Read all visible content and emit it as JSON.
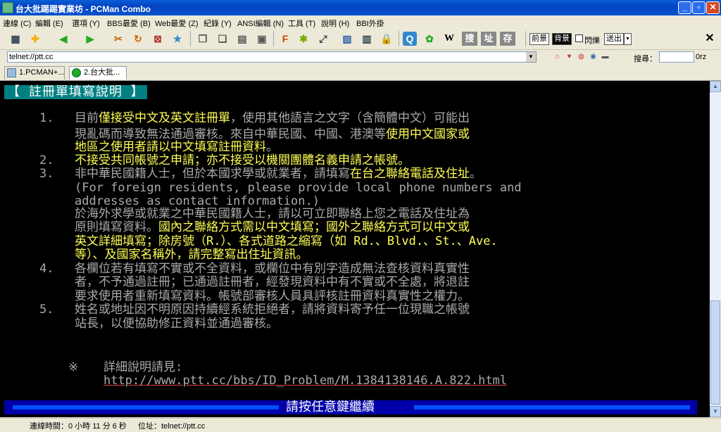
{
  "window": {
    "title": "台大批踢踢實業坊 - PCMan Combo"
  },
  "menubar": {
    "items": [
      "連線 (C)",
      "編輯 (E)",
      "選項 (Y)",
      "BBS最愛 (B)",
      "Web最愛 (Z)",
      "紀錄 (Y)",
      "ANSI編輯 (N)",
      "工具 (T)",
      "說明 (H)",
      "BBI外掛"
    ]
  },
  "toolbar": {
    "bg_front_label": "前景",
    "bg_back_label": "背景",
    "blink_label": "閃爍",
    "send_label": "送出",
    "search_label": "搜",
    "address_label": "址",
    "save_label": "存",
    "w_label": "W",
    "f_label": "F"
  },
  "addressbar": {
    "value": "telnet://ptt.cc",
    "search_label": "搜尋：",
    "search_engine": "0rz"
  },
  "tabs": [
    {
      "label": "1.PCMAN+..."
    },
    {
      "label": "2.台大批..."
    }
  ],
  "terminal": {
    "heading": "【 註冊單填寫說明 】",
    "lines": [
      {
        "num": "1.",
        "segments": [
          {
            "t": "目前",
            "c": "g"
          },
          {
            "t": "僅接受中文及英文註冊單",
            "c": "y"
          },
          {
            "t": "，使用其他語言之文字（含簡體中文）可能出",
            "c": "g"
          }
        ]
      },
      {
        "num": "",
        "segments": [
          {
            "t": "現亂碼而導致無法通過審核。來自中華民國、中國、港澳等",
            "c": "g"
          },
          {
            "t": "使用中文國家或",
            "c": "y"
          }
        ]
      },
      {
        "num": "",
        "segments": [
          {
            "t": "地區之使用者請以中文填寫註冊資料",
            "c": "y"
          },
          {
            "t": "。",
            "c": "g"
          }
        ]
      },
      {
        "num": "2.",
        "segments": [
          {
            "t": "不接受共同帳號之申請；亦不接受以機關團體名義申請之帳號。",
            "c": "y"
          }
        ]
      },
      {
        "num": "3.",
        "segments": [
          {
            "t": "非中華民國籍人士，但於本國求學或就業者，請填寫",
            "c": "g"
          },
          {
            "t": "在台之聯絡電話及住址",
            "c": "y"
          },
          {
            "t": "。",
            "c": "g"
          }
        ]
      },
      {
        "num": "",
        "segments": [
          {
            "t": "(For foreign residents, please provide local phone numbers and",
            "c": "g"
          }
        ]
      },
      {
        "num": "",
        "segments": [
          {
            "t": "addresses as contact information.)",
            "c": "g"
          }
        ]
      },
      {
        "num": "",
        "segments": [
          {
            "t": "於海外求學或就業之中華民國籍人士，請以可立即聯絡上您之電話及住址為",
            "c": "g"
          }
        ]
      },
      {
        "num": "",
        "segments": [
          {
            "t": "原則填寫資料。",
            "c": "g"
          },
          {
            "t": "國內之聯絡方式需以中文填寫；國外之聯絡方式可以中文或",
            "c": "y"
          }
        ]
      },
      {
        "num": "",
        "segments": [
          {
            "t": "英文詳細填寫；除房號（R.）、各式道路之縮寫（如 Rd.、Blvd.、St.、Ave.",
            "c": "y"
          }
        ]
      },
      {
        "num": "",
        "segments": [
          {
            "t": "等）、及國家名稱外，請完整寫出住址資訊。",
            "c": "y"
          }
        ]
      },
      {
        "num": "4.",
        "segments": [
          {
            "t": "各欄位若有填寫不實或不全資料，或欄位中有別字造成無法查核資料真實性",
            "c": "g"
          }
        ]
      },
      {
        "num": "",
        "segments": [
          {
            "t": "者，不予通過註冊；已通過註冊者，經發現資料中有不實或不全處，將退註",
            "c": "g"
          }
        ]
      },
      {
        "num": "",
        "segments": [
          {
            "t": "要求使用者重新填寫資料。帳號部審核人員具評核註冊資料真實性之權力。",
            "c": "g"
          }
        ]
      },
      {
        "num": "5.",
        "segments": [
          {
            "t": "姓名或地址因不明原因持續經系統拒絕者，請將資料寄予任一位現職之帳號",
            "c": "g"
          }
        ]
      },
      {
        "num": "",
        "segments": [
          {
            "t": "站長，以便協助修正資料並通過審核。",
            "c": "g"
          }
        ]
      }
    ],
    "note_mark": "※",
    "note_text": "詳細說明請見:",
    "note_url": "http://www.ptt.cc/bbs/ID_Problem/M.1384138146.A.822.html",
    "footer_text": "請按任意鍵繼續"
  },
  "statusbar": {
    "connection_time": "連線時間：0 小時 11 分 6 秒",
    "address": "位址：telnet://ptt.cc"
  },
  "colors": {
    "terminal_bg": "#000000",
    "text_gray": "#aaaaaa",
    "text_yellow": "#ffff55",
    "heading_bg": "#008080",
    "footer_bg": "#0000aa"
  }
}
